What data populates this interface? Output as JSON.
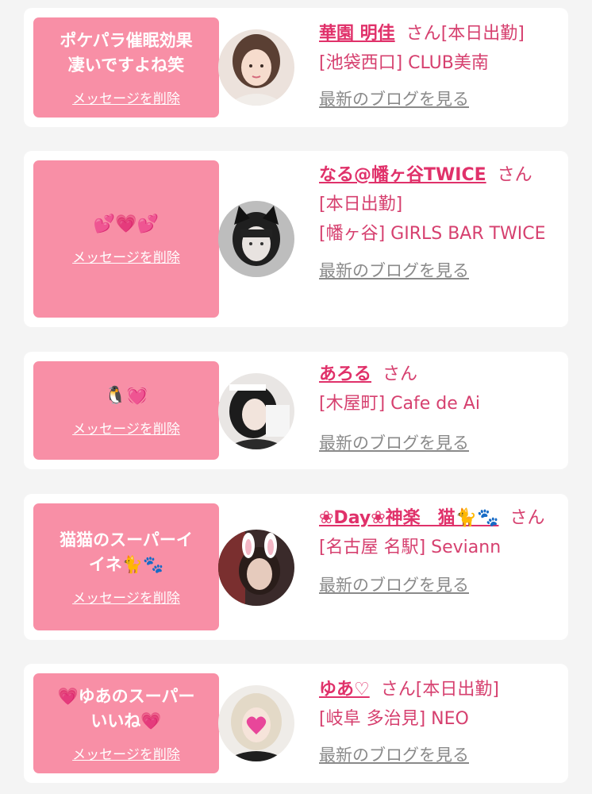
{
  "delete_label": "メッセージを削除",
  "blog_label": "最新のブログを見る",
  "san_label": "さん",
  "cards": [
    {
      "message_lines": [
        "ポケパラ催眠効果",
        "凄いですよね笑"
      ],
      "name": "華園 明佳",
      "status": "[本日出勤]",
      "shop": "[池袋西口] CLUB美南"
    },
    {
      "message": "💕💗💕",
      "name": "なる@幡ヶ谷TWICE",
      "status": "[本日出勤]",
      "shop": "[幡ヶ谷] GIRLS BAR TWICE"
    },
    {
      "message": "🐧💓",
      "name": "あろる",
      "shop": "[木屋町] Cafe de Ai"
    },
    {
      "message_lines": [
        "猫猫のスーパーイ",
        "イネ🐈🐾"
      ],
      "name": "❀Day❀神楽　猫🐈🐾",
      "shop": "[名古屋 名駅] Seviann"
    },
    {
      "message_lines": [
        "💗ゆあのスーパー",
        "いいね💗"
      ],
      "name": "ゆあ♡",
      "status": "[本日出勤]",
      "shop": "[岐阜 多治見] NEO"
    }
  ],
  "colors": {
    "bubble": "#f88fa6",
    "name": "#e0316a",
    "text": "#d6406f",
    "link_gray": "#8a8a8a",
    "background": "#f4f4f4"
  }
}
